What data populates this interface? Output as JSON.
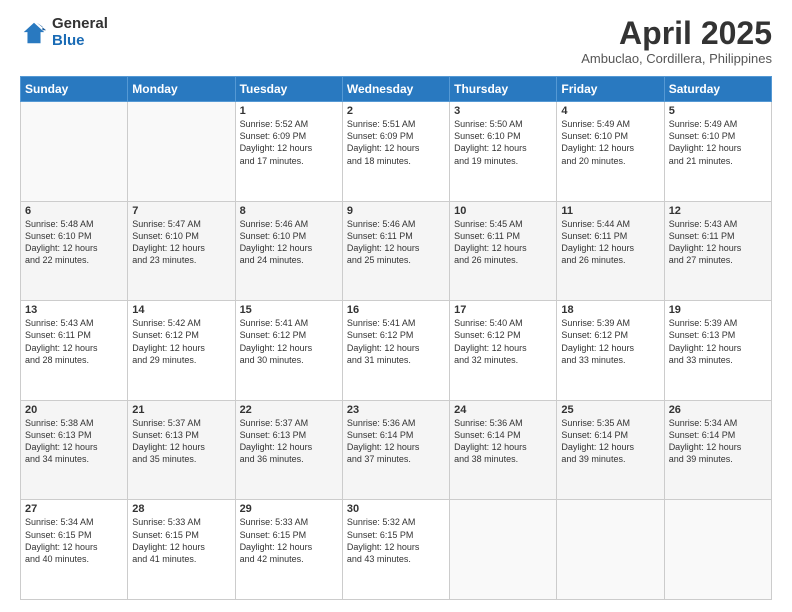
{
  "logo": {
    "general": "General",
    "blue": "Blue"
  },
  "header": {
    "month": "April 2025",
    "location": "Ambuclao, Cordillera, Philippines"
  },
  "weekdays": [
    "Sunday",
    "Monday",
    "Tuesday",
    "Wednesday",
    "Thursday",
    "Friday",
    "Saturday"
  ],
  "weeks": [
    [
      {
        "day": "",
        "info": ""
      },
      {
        "day": "",
        "info": ""
      },
      {
        "day": "1",
        "info": "Sunrise: 5:52 AM\nSunset: 6:09 PM\nDaylight: 12 hours\nand 17 minutes."
      },
      {
        "day": "2",
        "info": "Sunrise: 5:51 AM\nSunset: 6:09 PM\nDaylight: 12 hours\nand 18 minutes."
      },
      {
        "day": "3",
        "info": "Sunrise: 5:50 AM\nSunset: 6:10 PM\nDaylight: 12 hours\nand 19 minutes."
      },
      {
        "day": "4",
        "info": "Sunrise: 5:49 AM\nSunset: 6:10 PM\nDaylight: 12 hours\nand 20 minutes."
      },
      {
        "day": "5",
        "info": "Sunrise: 5:49 AM\nSunset: 6:10 PM\nDaylight: 12 hours\nand 21 minutes."
      }
    ],
    [
      {
        "day": "6",
        "info": "Sunrise: 5:48 AM\nSunset: 6:10 PM\nDaylight: 12 hours\nand 22 minutes."
      },
      {
        "day": "7",
        "info": "Sunrise: 5:47 AM\nSunset: 6:10 PM\nDaylight: 12 hours\nand 23 minutes."
      },
      {
        "day": "8",
        "info": "Sunrise: 5:46 AM\nSunset: 6:10 PM\nDaylight: 12 hours\nand 24 minutes."
      },
      {
        "day": "9",
        "info": "Sunrise: 5:46 AM\nSunset: 6:11 PM\nDaylight: 12 hours\nand 25 minutes."
      },
      {
        "day": "10",
        "info": "Sunrise: 5:45 AM\nSunset: 6:11 PM\nDaylight: 12 hours\nand 26 minutes."
      },
      {
        "day": "11",
        "info": "Sunrise: 5:44 AM\nSunset: 6:11 PM\nDaylight: 12 hours\nand 26 minutes."
      },
      {
        "day": "12",
        "info": "Sunrise: 5:43 AM\nSunset: 6:11 PM\nDaylight: 12 hours\nand 27 minutes."
      }
    ],
    [
      {
        "day": "13",
        "info": "Sunrise: 5:43 AM\nSunset: 6:11 PM\nDaylight: 12 hours\nand 28 minutes."
      },
      {
        "day": "14",
        "info": "Sunrise: 5:42 AM\nSunset: 6:12 PM\nDaylight: 12 hours\nand 29 minutes."
      },
      {
        "day": "15",
        "info": "Sunrise: 5:41 AM\nSunset: 6:12 PM\nDaylight: 12 hours\nand 30 minutes."
      },
      {
        "day": "16",
        "info": "Sunrise: 5:41 AM\nSunset: 6:12 PM\nDaylight: 12 hours\nand 31 minutes."
      },
      {
        "day": "17",
        "info": "Sunrise: 5:40 AM\nSunset: 6:12 PM\nDaylight: 12 hours\nand 32 minutes."
      },
      {
        "day": "18",
        "info": "Sunrise: 5:39 AM\nSunset: 6:12 PM\nDaylight: 12 hours\nand 33 minutes."
      },
      {
        "day": "19",
        "info": "Sunrise: 5:39 AM\nSunset: 6:13 PM\nDaylight: 12 hours\nand 33 minutes."
      }
    ],
    [
      {
        "day": "20",
        "info": "Sunrise: 5:38 AM\nSunset: 6:13 PM\nDaylight: 12 hours\nand 34 minutes."
      },
      {
        "day": "21",
        "info": "Sunrise: 5:37 AM\nSunset: 6:13 PM\nDaylight: 12 hours\nand 35 minutes."
      },
      {
        "day": "22",
        "info": "Sunrise: 5:37 AM\nSunset: 6:13 PM\nDaylight: 12 hours\nand 36 minutes."
      },
      {
        "day": "23",
        "info": "Sunrise: 5:36 AM\nSunset: 6:14 PM\nDaylight: 12 hours\nand 37 minutes."
      },
      {
        "day": "24",
        "info": "Sunrise: 5:36 AM\nSunset: 6:14 PM\nDaylight: 12 hours\nand 38 minutes."
      },
      {
        "day": "25",
        "info": "Sunrise: 5:35 AM\nSunset: 6:14 PM\nDaylight: 12 hours\nand 39 minutes."
      },
      {
        "day": "26",
        "info": "Sunrise: 5:34 AM\nSunset: 6:14 PM\nDaylight: 12 hours\nand 39 minutes."
      }
    ],
    [
      {
        "day": "27",
        "info": "Sunrise: 5:34 AM\nSunset: 6:15 PM\nDaylight: 12 hours\nand 40 minutes."
      },
      {
        "day": "28",
        "info": "Sunrise: 5:33 AM\nSunset: 6:15 PM\nDaylight: 12 hours\nand 41 minutes."
      },
      {
        "day": "29",
        "info": "Sunrise: 5:33 AM\nSunset: 6:15 PM\nDaylight: 12 hours\nand 42 minutes."
      },
      {
        "day": "30",
        "info": "Sunrise: 5:32 AM\nSunset: 6:15 PM\nDaylight: 12 hours\nand 43 minutes."
      },
      {
        "day": "",
        "info": ""
      },
      {
        "day": "",
        "info": ""
      },
      {
        "day": "",
        "info": ""
      }
    ]
  ]
}
